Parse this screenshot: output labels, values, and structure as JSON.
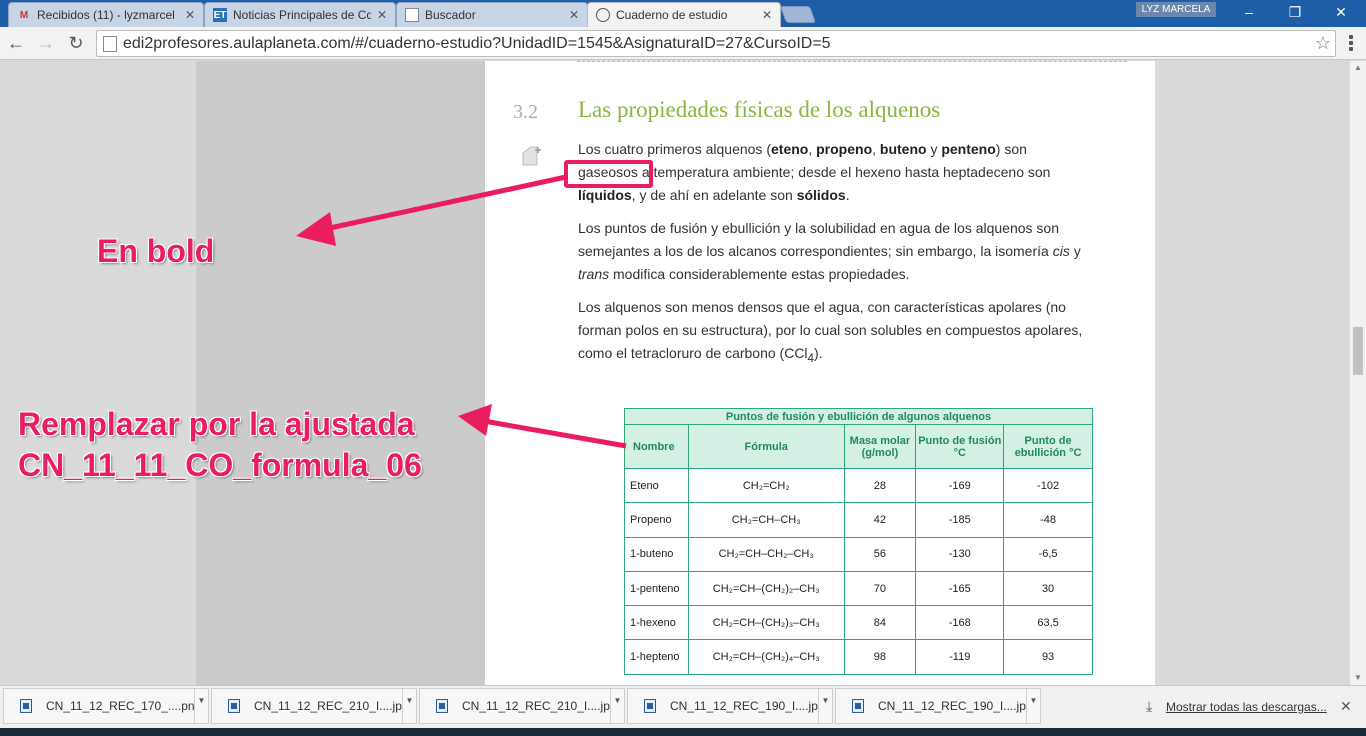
{
  "tabs": [
    {
      "title": "Recibidos (11) - lyzmarcel",
      "icon": "gmail-icon"
    },
    {
      "title": "Noticias Principales de Co",
      "icon": "news-icon"
    },
    {
      "title": "Buscador",
      "icon": "document-icon"
    },
    {
      "title": "Cuaderno de estudio",
      "icon": "globe-icon",
      "active": true
    }
  ],
  "user_badge": "LYZ MARCELA",
  "address": {
    "url": "edi2profesores.aulaplaneta.com/#/cuaderno-estudio?UnidadID=1545&AsignaturaID=27&CursoID=5"
  },
  "section": {
    "number": "3.2",
    "title": "Las propiedades físicas de los alquenos"
  },
  "paragraphs": {
    "p1": {
      "t1": "Los cuatro primeros alquenos (",
      "b1": "eteno",
      "t2": ", ",
      "b2": "propeno",
      "t3": ", ",
      "b3": "buteno",
      "t4": " y ",
      "b4": "penteno",
      "t5": ") son",
      "t6": "gaseosos",
      "t7": " a temperatura ambiente; desde el hexeno hasta heptadeceno son",
      "b5": "líquidos",
      "t8": ", y de ahí en adelante son ",
      "b6": "sólidos",
      "t9": "."
    },
    "p2": {
      "t1": "Los puntos de fusión y ebullición y la solubilidad en agua de los alquenos son semejantes a los de los alcanos correspondientes; sin embargo, la isomería ",
      "i1": "cis",
      "t2": " y",
      "i2": "trans",
      "t3": " modifica considerablemente estas propiedades."
    },
    "p3": {
      "t1": "Los alquenos son menos densos que el agua, con características apolares (no forman polos en su estructura), por lo cual son solubles en compuestos apolares, como el tetracloruro de carbono (CCl",
      "sub": "4",
      "t2": ")."
    }
  },
  "table": {
    "caption": "Puntos de fusión y ebullición de algunos alquenos",
    "headers": [
      "Nombre",
      "Fórmula",
      "Masa molar (g/mol)",
      "Punto de fusión °C",
      "Punto de ebullición °C"
    ],
    "rows": [
      {
        "name": "Eteno",
        "formula": "CH₂=CH₂",
        "mass": "28",
        "fusion": "-169",
        "ebullition": "-102"
      },
      {
        "name": "Propeno",
        "formula": "CH₂=CH–CH₃",
        "mass": "42",
        "fusion": "-185",
        "ebullition": "-48"
      },
      {
        "name": "1-buteno",
        "formula": "CH₂=CH–CH₂–CH₃",
        "mass": "56",
        "fusion": "-130",
        "ebullition": "-6,5"
      },
      {
        "name": "1-penteno",
        "formula": "CH₂=CH–(CH₂)₂–CH₃",
        "mass": "70",
        "fusion": "-165",
        "ebullition": "30"
      },
      {
        "name": "1-hexeno",
        "formula": "CH₂=CH–(CH₂)₃–CH₃",
        "mass": "84",
        "fusion": "-168",
        "ebullition": "63,5"
      },
      {
        "name": "1-hepteno",
        "formula": "CH₂=CH–(CH₂)₄–CH₃",
        "mass": "98",
        "fusion": "-119",
        "ebullition": "93"
      }
    ]
  },
  "annotations": {
    "bold": "En bold",
    "replace_line1": "Remplazar por la ajustada",
    "replace_line2": "CN_11_11_CO_formula_06"
  },
  "downloads": [
    {
      "name": "CN_11_12_REC_170_....png"
    },
    {
      "name": "CN_11_12_REC_210_I....jpg"
    },
    {
      "name": "CN_11_12_REC_210_I....jpg"
    },
    {
      "name": "CN_11_12_REC_190_I....jpg"
    },
    {
      "name": "CN_11_12_REC_190_I....jpg"
    }
  ],
  "show_all_downloads": "Mostrar todas las descargas...",
  "colors": {
    "accent": "#ea1d5f",
    "section_title": "#8db53e",
    "table_green": "#2ea87a"
  }
}
